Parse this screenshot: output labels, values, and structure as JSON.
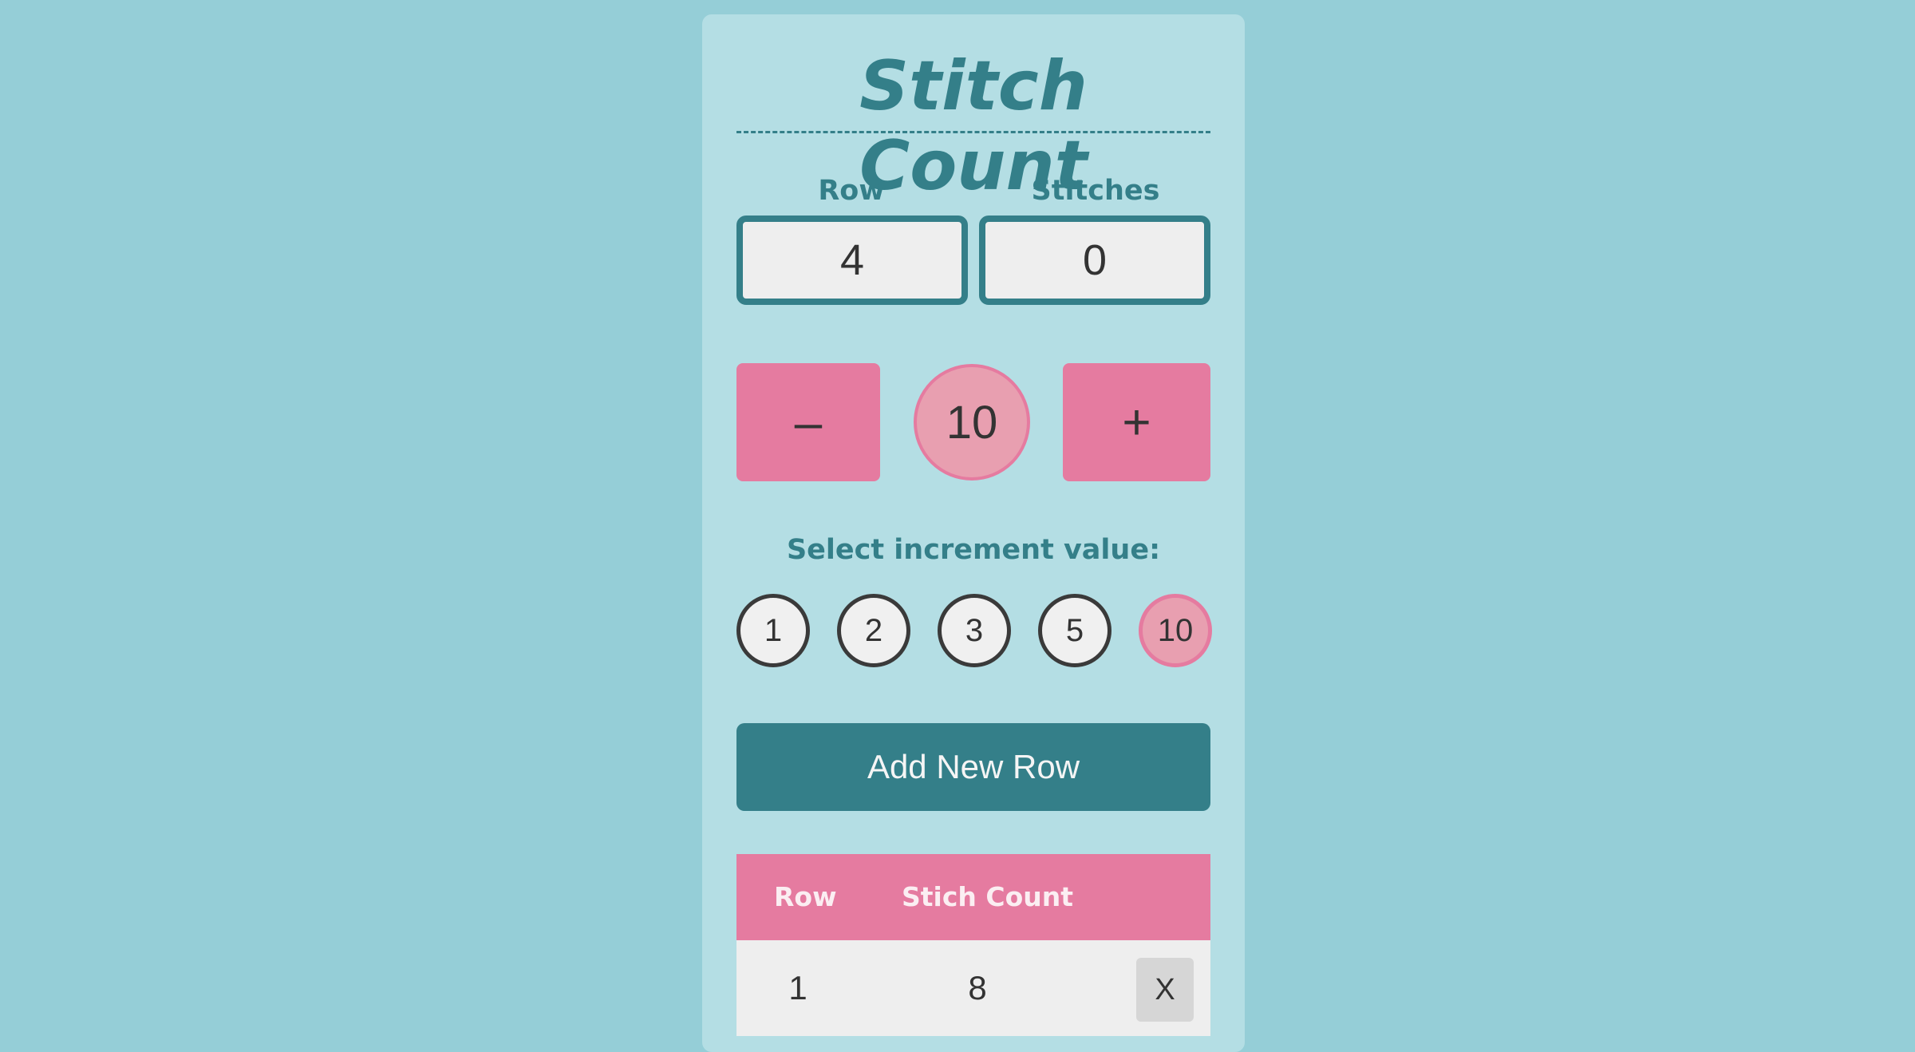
{
  "app": {
    "title": "Stitch Count"
  },
  "counter": {
    "row_label": "Row",
    "row_value": "4",
    "stitches_label": "Stitches",
    "stitches_value": "0"
  },
  "controls": {
    "decrement_label": "–",
    "increment_display": "10",
    "increment_label": "+"
  },
  "increment_selector": {
    "label": "Select increment value:",
    "options": [
      "1",
      "2",
      "3",
      "5",
      "10"
    ],
    "selected": "10"
  },
  "actions": {
    "add_row_label": "Add New Row"
  },
  "table": {
    "headers": [
      "Row",
      "Stich Count"
    ],
    "rows": [
      {
        "row": "1",
        "count": "8",
        "delete_label": "X"
      }
    ]
  },
  "colors": {
    "page_background": "#95ced7",
    "panel_background": "#b4dee4",
    "teal_accent": "#347f89",
    "pink_accent": "#e57ba0",
    "pink_light": "#e89fb0"
  }
}
